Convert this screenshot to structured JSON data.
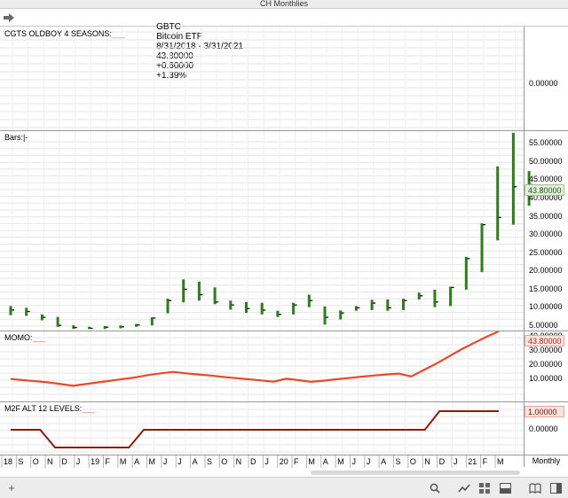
{
  "window": {
    "title": "CH Monthlies"
  },
  "header": {
    "symbol": "GBTC",
    "name": "Bitcoin ETF",
    "range": "8/31/2018 - 3/31/2021",
    "last": "43.80000",
    "change": "+0.60000",
    "change_pct": "+1.39%"
  },
  "panels": {
    "oldboy": {
      "label": "CGTS OLDBOY 4 SEASONS:",
      "dash": "___",
      "tick": "0.00000"
    },
    "bars": {
      "label": "Bars:",
      "dash": "|-",
      "last_tag": "43.80000",
      "ticks": [
        "55.00000",
        "50.00000",
        "45.00000",
        "40.00000",
        "35.00000",
        "30.00000",
        "25.00000",
        "20.00000",
        "15.00000",
        "10.00000",
        "5.00000"
      ]
    },
    "momo": {
      "label": "MOMO:",
      "dash": "___",
      "last_tag": "43.80000",
      "ticks": [
        "40.00000",
        "30.00000",
        "20.00000",
        "10.00000"
      ]
    },
    "m2f": {
      "label": "M2F ALT 12 LEVELS:",
      "dash": "___",
      "last_tag": "1.00000",
      "tick": "0.00000"
    }
  },
  "x_axis": {
    "labels": [
      "18",
      "S",
      "O",
      "N",
      "D",
      "J",
      "19",
      "F",
      "M",
      "A",
      "M",
      "J",
      "J",
      "A",
      "S",
      "O",
      "N",
      "D",
      "J",
      "20",
      "F",
      "M",
      "A",
      "M",
      "J",
      "J",
      "A",
      "S",
      "O",
      "N",
      "D",
      "J",
      "21",
      "F",
      "M"
    ],
    "period": "Monthly"
  },
  "colors": {
    "up_bar": "#2f7d1e",
    "momo_line": "#e8492a",
    "m2f_line": "#8b1c0e",
    "grid": "#e6e6e6"
  },
  "chart_data": {
    "type": "ohlc",
    "title": "GBTC Bitcoin ETF",
    "months": [
      "2018-08",
      "2018-09",
      "2018-10",
      "2018-11",
      "2018-12",
      "2019-01",
      "2019-02",
      "2019-03",
      "2019-04",
      "2019-05",
      "2019-06",
      "2019-07",
      "2019-08",
      "2019-09",
      "2019-10",
      "2019-11",
      "2019-12",
      "2020-01",
      "2020-02",
      "2020-03",
      "2020-04",
      "2020-05",
      "2020-06",
      "2020-07",
      "2020-08",
      "2020-09",
      "2020-10",
      "2020-11",
      "2020-12",
      "2021-01",
      "2021-02",
      "2021-03"
    ],
    "bars": [
      {
        "high": 10.5,
        "low": 8.0,
        "close": 9.4
      },
      {
        "high": 10.0,
        "low": 7.8,
        "close": 9.0
      },
      {
        "high": 8.2,
        "low": 6.6,
        "close": 7.4
      },
      {
        "high": 7.5,
        "low": 4.8,
        "close": 5.2
      },
      {
        "high": 5.2,
        "low": 4.2,
        "close": 4.6
      },
      {
        "high": 4.8,
        "low": 4.2,
        "close": 4.4
      },
      {
        "high": 5.0,
        "low": 4.2,
        "close": 4.7
      },
      {
        "high": 5.2,
        "low": 4.4,
        "close": 4.8
      },
      {
        "high": 5.6,
        "low": 4.8,
        "close": 5.3
      },
      {
        "high": 7.4,
        "low": 5.2,
        "close": 7.2
      },
      {
        "high": 12.5,
        "low": 8.5,
        "close": 12.0
      },
      {
        "high": 17.8,
        "low": 11.5,
        "close": 15.1
      },
      {
        "high": 17.2,
        "low": 12.0,
        "close": 13.6
      },
      {
        "high": 15.6,
        "low": 11.0,
        "close": 11.6
      },
      {
        "high": 12.0,
        "low": 9.5,
        "close": 10.8
      },
      {
        "high": 11.6,
        "low": 8.6,
        "close": 9.8
      },
      {
        "high": 11.4,
        "low": 8.2,
        "close": 9.4
      },
      {
        "high": 9.2,
        "low": 7.5,
        "close": 8.2
      },
      {
        "high": 11.4,
        "low": 8.2,
        "close": 10.8
      },
      {
        "high": 13.6,
        "low": 10.2,
        "close": 12.0
      },
      {
        "high": 10.4,
        "low": 5.4,
        "close": 7.4
      },
      {
        "high": 9.3,
        "low": 6.8,
        "close": 8.6
      },
      {
        "high": 10.5,
        "low": 9.2,
        "close": 10.0
      },
      {
        "high": 12.2,
        "low": 9.4,
        "close": 11.3
      },
      {
        "high": 12.3,
        "low": 9.2,
        "close": 10.0
      },
      {
        "high": 12.5,
        "low": 9.4,
        "close": 12.0
      },
      {
        "high": 14.2,
        "low": 12.3,
        "close": 13.3
      },
      {
        "high": 15.0,
        "low": 10.2,
        "close": 11.6
      },
      {
        "high": 15.8,
        "low": 10.5,
        "close": 15.6
      },
      {
        "high": 24.0,
        "low": 15.0,
        "close": 23.5
      },
      {
        "high": 33.2,
        "low": 19.8,
        "close": 32.8
      },
      {
        "high": 48.8,
        "low": 28.5,
        "close": 34.8
      },
      {
        "high": 58.0,
        "low": 32.8,
        "close": 43.2
      },
      {
        "high": 47.5,
        "low": 38.0,
        "close": 43.8
      }
    ],
    "ylim": [
      5,
      57
    ],
    "momo": [
      10.2,
      9.4,
      8.6,
      7.8,
      6.6,
      5.4,
      6.6,
      7.8,
      9.0,
      10.2,
      11.4,
      13.0,
      14.2,
      15.2,
      14.2,
      13.4,
      12.6,
      11.6,
      10.8,
      10.0,
      9.2,
      8.3,
      10.4,
      9.4,
      8.2,
      9.0,
      10.0,
      10.8,
      11.8,
      12.6,
      13.4,
      14.0,
      12.0,
      16.5,
      21.0,
      26.0,
      31.0,
      35.5,
      39.8,
      43.8
    ],
    "momo_ylim": [
      0,
      45
    ],
    "m2f": [
      1,
      1,
      1,
      -1,
      -1,
      -1,
      -1,
      -1,
      -1,
      1,
      1,
      1,
      1,
      1,
      1,
      1,
      1,
      1,
      1,
      1,
      1,
      1,
      1,
      1,
      1,
      1,
      1,
      1,
      1,
      2,
      2,
      2,
      2,
      2
    ]
  }
}
